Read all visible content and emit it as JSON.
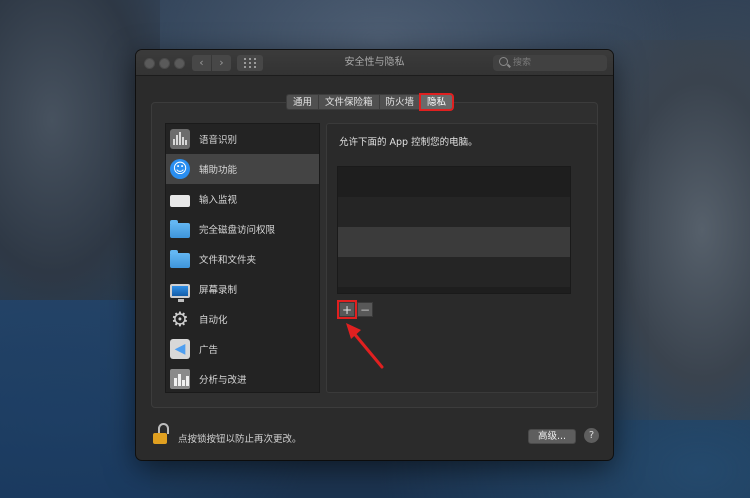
{
  "window": {
    "title": "安全性与隐私",
    "search_placeholder": "搜索"
  },
  "tabs": [
    {
      "label": "通用",
      "active": false
    },
    {
      "label": "文件保险箱",
      "active": false
    },
    {
      "label": "防火墙",
      "active": false
    },
    {
      "label": "隐私",
      "active": true
    }
  ],
  "sidebar": {
    "items": [
      {
        "label": "语音识别",
        "icon": "speech-recognition-icon"
      },
      {
        "label": "辅助功能",
        "icon": "accessibility-icon",
        "selected": true
      },
      {
        "label": "输入监视",
        "icon": "keyboard-icon"
      },
      {
        "label": "完全磁盘访问权限",
        "icon": "folder-icon"
      },
      {
        "label": "文件和文件夹",
        "icon": "folder-icon"
      },
      {
        "label": "屏幕录制",
        "icon": "display-icon"
      },
      {
        "label": "自动化",
        "icon": "gear-icon"
      },
      {
        "label": "广告",
        "icon": "megaphone-icon"
      },
      {
        "label": "分析与改进",
        "icon": "analytics-icon"
      }
    ]
  },
  "main": {
    "description": "允许下面的 App 控制您的电脑。",
    "add_label": "+",
    "remove_label": "−"
  },
  "footer": {
    "lock_text": "点按锁按钮以防止再次更改。",
    "advanced_label": "高级...",
    "help_label": "?"
  },
  "colors": {
    "highlight": "#e02020",
    "accent": "#2a8ef0"
  }
}
